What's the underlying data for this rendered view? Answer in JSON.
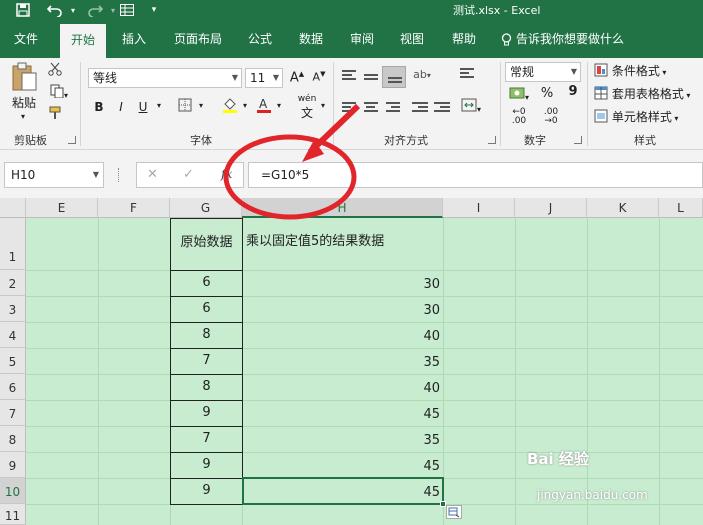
{
  "window": {
    "title": "测试.xlsx  -  Excel"
  },
  "quick_access": {
    "save": "save-icon",
    "undo": "undo-icon",
    "redo": "redo-icon",
    "form": "form-icon",
    "customize": "customize-qat-icon"
  },
  "tabs": [
    "文件",
    "开始",
    "插入",
    "页面布局",
    "公式",
    "数据",
    "审阅",
    "视图",
    "帮助"
  ],
  "tell_me": "告诉我你想要做什么",
  "ribbon": {
    "clipboard": {
      "paste_label": "粘贴",
      "group_label": "剪贴板"
    },
    "font": {
      "font_name": "等线",
      "font_size": "11",
      "bold": "B",
      "italic": "I",
      "underline": "U",
      "phonetic": "wén",
      "group_label": "字体"
    },
    "alignment": {
      "group_label": "对齐方式"
    },
    "number": {
      "format": "常规",
      "percent": "%",
      "comma": "9",
      "group_label": "数字"
    },
    "styles": {
      "conditional": "条件格式",
      "table": "套用表格格式",
      "cell": "单元格样式",
      "group_label": "样式"
    }
  },
  "formula_bar": {
    "name_box": "H10",
    "cancel": "✕",
    "enter": "✓",
    "fx": "fx",
    "formula": "=G10*5"
  },
  "columns": [
    "E",
    "F",
    "G",
    "H",
    "I",
    "J",
    "K",
    "L"
  ],
  "rows": [
    "1",
    "2",
    "3",
    "4",
    "5",
    "6",
    "7",
    "8",
    "9",
    "10",
    "11"
  ],
  "table": {
    "header_g": "原始数据",
    "header_h": "乘以固定值5的结果数据",
    "g_values": [
      "6",
      "6",
      "8",
      "7",
      "8",
      "9",
      "7",
      "9",
      "9"
    ],
    "h_values": [
      "30",
      "30",
      "40",
      "35",
      "40",
      "45",
      "35",
      "45",
      "45"
    ]
  },
  "watermark": {
    "brand": "Bai 经验",
    "url": "jingyan.baidu.com"
  },
  "colors": {
    "accent": "#217346",
    "sheet_bg": "#c7eccf",
    "annotation": "#e0262b"
  }
}
